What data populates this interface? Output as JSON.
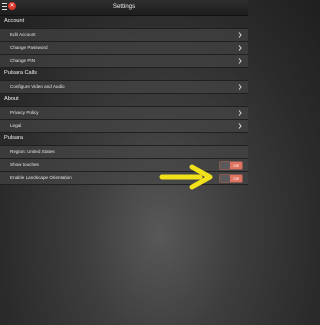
{
  "header": {
    "title": "Settings",
    "menu_icon": "hamburger-icon",
    "logo_icon": "pulsara-logo-icon"
  },
  "sections": {
    "account": {
      "title": "Account",
      "items": [
        "Edit Account",
        "Change Password",
        "Change PIN"
      ]
    },
    "calls": {
      "title": "Pulsara Calls",
      "items": [
        "Configure Video and Audio"
      ]
    },
    "about": {
      "title": "About",
      "items": [
        "Privacy Policy",
        "Legal"
      ]
    },
    "pulsara": {
      "title": "Pulsara",
      "region": "Region: United States",
      "show_touches": {
        "label": "Show touches",
        "state": "Off"
      },
      "landscape": {
        "label": "Enable Landscape Orientation",
        "state": "Off"
      }
    }
  },
  "colors": {
    "accent": "#e07462",
    "arrow": "#f1e11b"
  }
}
